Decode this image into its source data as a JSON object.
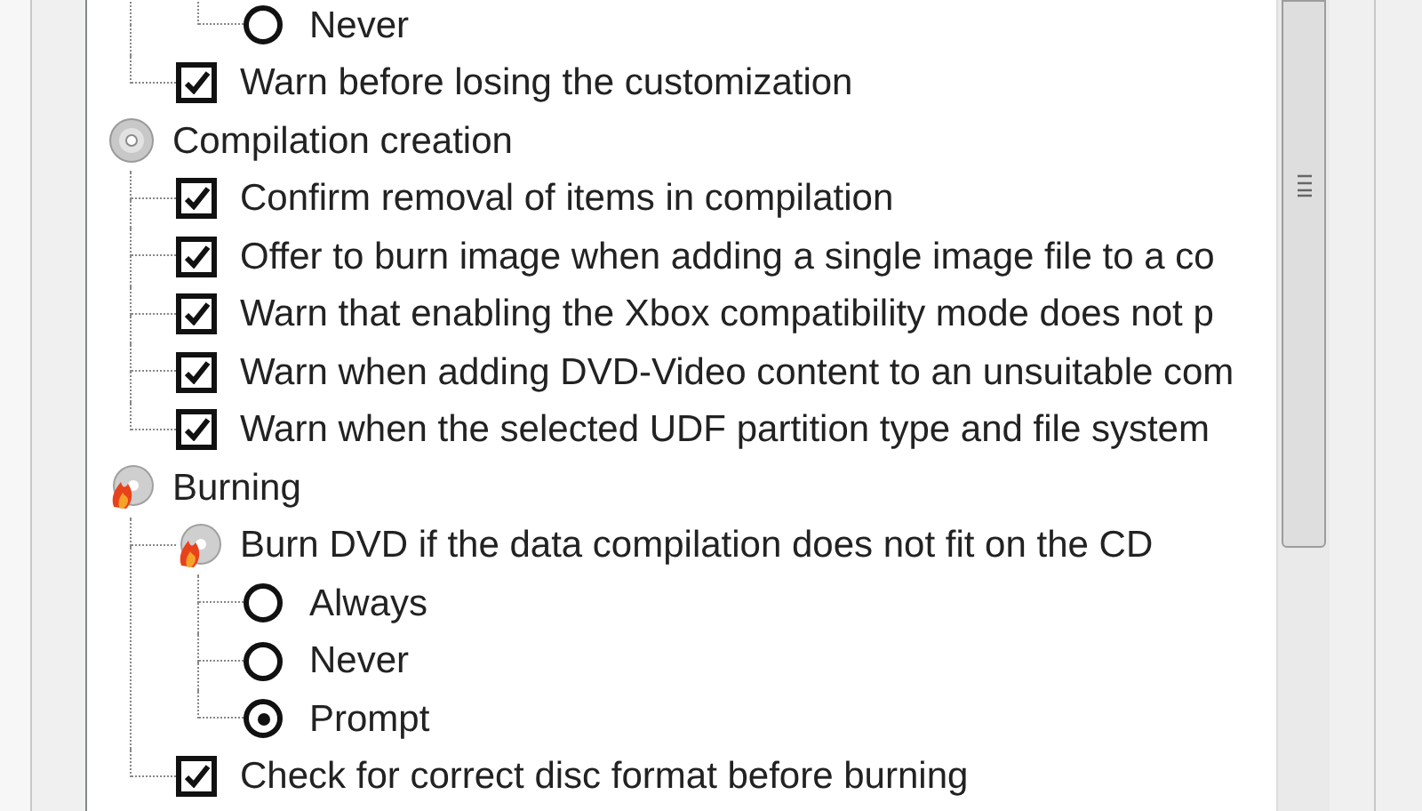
{
  "tree": [
    {
      "children": [
        {
          "children": [
            {
              "kind": "radio",
              "label": "Never",
              "selected": false
            }
          ]
        },
        {
          "kind": "checkbox",
          "label": "Warn before losing the customization",
          "checked": true
        }
      ]
    },
    {
      "kind": "disc-group",
      "label": "Compilation creation",
      "children": [
        {
          "kind": "checkbox",
          "label": "Confirm removal of items in compilation",
          "checked": true
        },
        {
          "kind": "checkbox",
          "label": "Offer to burn image when adding a single image file to a co",
          "checked": true
        },
        {
          "kind": "checkbox",
          "label": "Warn that enabling the Xbox compatibility mode does not p",
          "checked": true
        },
        {
          "kind": "checkbox",
          "label": "Warn when adding DVD-Video content to an unsuitable com",
          "checked": true
        },
        {
          "kind": "checkbox",
          "label": "Warn when the selected UDF partition type and file system",
          "checked": true
        }
      ]
    },
    {
      "kind": "burn-group",
      "label": "Burning",
      "children": [
        {
          "kind": "burn-option",
          "label": "Burn DVD if the data compilation does not fit on the CD",
          "children": [
            {
              "kind": "radio",
              "label": "Always",
              "selected": false
            },
            {
              "kind": "radio",
              "label": "Never",
              "selected": false
            },
            {
              "kind": "radio",
              "label": "Prompt",
              "selected": true
            }
          ]
        },
        {
          "kind": "checkbox",
          "label": "Check for correct disc format before burning",
          "checked": true
        }
      ]
    }
  ]
}
